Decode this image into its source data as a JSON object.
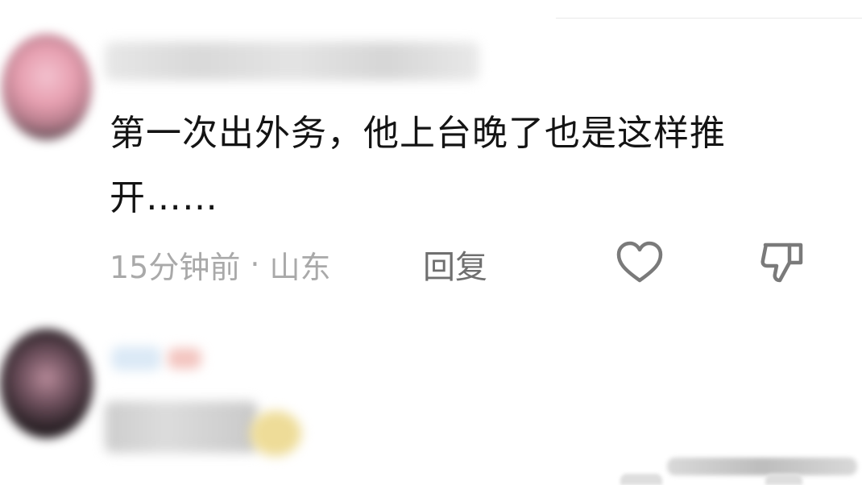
{
  "comment_1": {
    "text": "第一次出外务，他上台晚了也是这样推开……",
    "time": "15分钟前",
    "separator": "·",
    "location": "山东",
    "reply_label": "回复",
    "like_icon": "heart-outline-icon",
    "dislike_icon": "thumbs-down-outline-icon"
  },
  "colors": {
    "text_primary": "#141414",
    "text_meta": "#a9a9a9",
    "reply_text": "#6f6f6f",
    "icon_stroke": "#7a7a7a"
  }
}
